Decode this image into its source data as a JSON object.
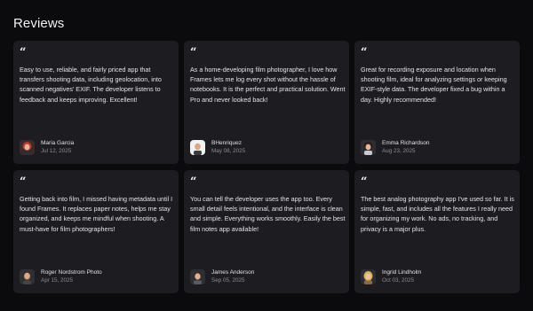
{
  "page": {
    "title": "Reviews"
  },
  "reviews": [
    {
      "text": "Easy to use, reliable, and fairly priced app that transfers shooting data, including geolocation, into scanned negatives' EXIF. The developer listens to feedback and keeps improving. Excellent!",
      "name": "Maria Garcia",
      "date": "Jul 12, 2025",
      "avatar": "avatar-woman-red-hair"
    },
    {
      "text": "As a home-developing film photographer, I love how Frames lets me log every shot without the hassle of notebooks. It is the perfect and practical solution. Went Pro and never looked back!",
      "name": "BHenriquez",
      "date": "May 08, 2025",
      "avatar": "avatar-man-bald"
    },
    {
      "text": "Great for recording exposure and location when shooting film, ideal for analyzing settings or keeping EXIF-style data. The developer fixed a bug within a day. Highly recommended!",
      "name": "Emma Richardson",
      "date": "Aug 23, 2025",
      "avatar": "avatar-woman-dark-hair"
    },
    {
      "text": "Getting back into film, I missed having metadata until I found Frames. It replaces paper notes, helps me stay organized, and keeps me mindful when shooting. A must-have for film photographers!",
      "name": "Roger Nordstrom Photo",
      "date": "Apr 15, 2025",
      "avatar": "avatar-man-beard"
    },
    {
      "text": "You can tell the developer uses the app too. Every small detail feels intentional, and the interface is clean and simple. Everything works smoothly. Easily the best film notes app available!",
      "name": "James Anderson",
      "date": "Sep 05, 2025",
      "avatar": "avatar-man-short-hair"
    },
    {
      "text": "The best analog photography app I've used so far. It is simple, fast, and includes all the features I really need for organizing my work. No ads, no tracking, and privacy is a major plus.",
      "name": "Ingrid Lindholm",
      "date": "Oct 03, 2025",
      "avatar": "avatar-woman-blonde"
    }
  ]
}
